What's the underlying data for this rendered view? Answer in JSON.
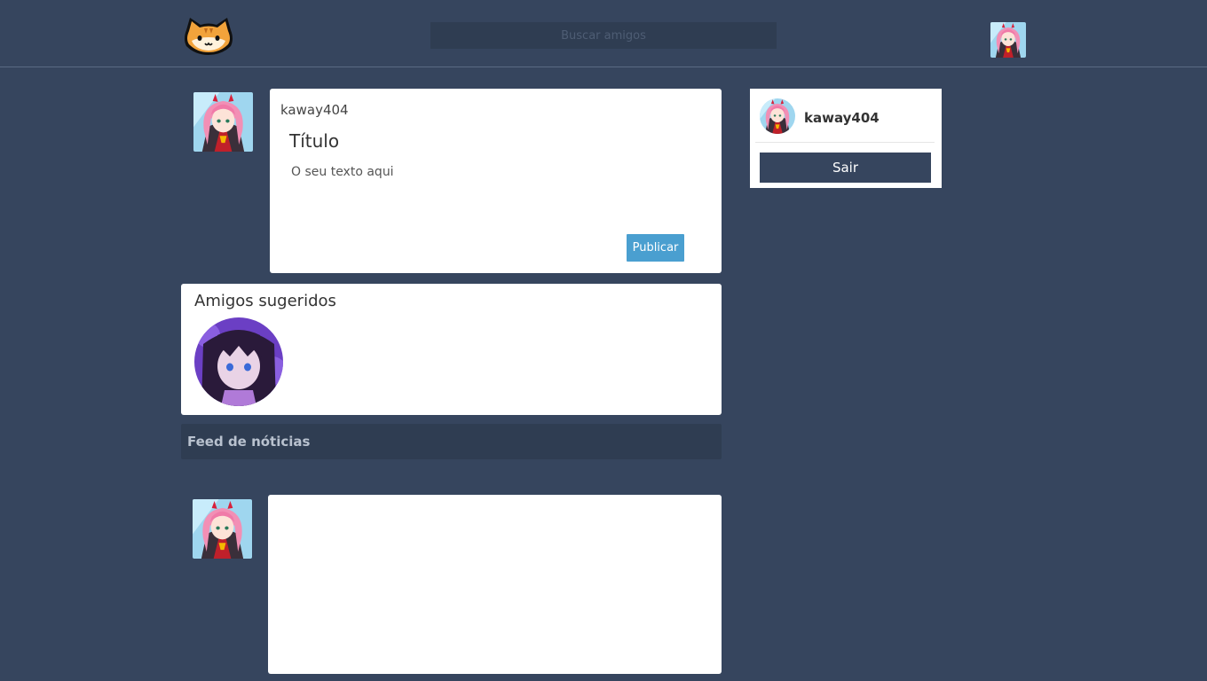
{
  "header": {
    "logo_icon": "cat-face-icon",
    "search_placeholder": "Buscar amigos",
    "avatar_icon": "user-avatar-icon"
  },
  "composer": {
    "username": "kaway404",
    "title_placeholder": "Título",
    "text_placeholder": "O seu texto aqui",
    "publish_label": "Publicar"
  },
  "suggestions": {
    "heading": "Amigos sugeridos",
    "friends": [
      {
        "avatar_icon": "friend-avatar-icon"
      }
    ]
  },
  "feed": {
    "heading": "Feed de nóticias"
  },
  "profile_card": {
    "username": "kaway404",
    "logout_label": "Sair"
  },
  "colors": {
    "background": "#36455e",
    "dark_panel": "#2f3d52",
    "publish_button": "#4a9fd0",
    "card": "#ffffff"
  }
}
